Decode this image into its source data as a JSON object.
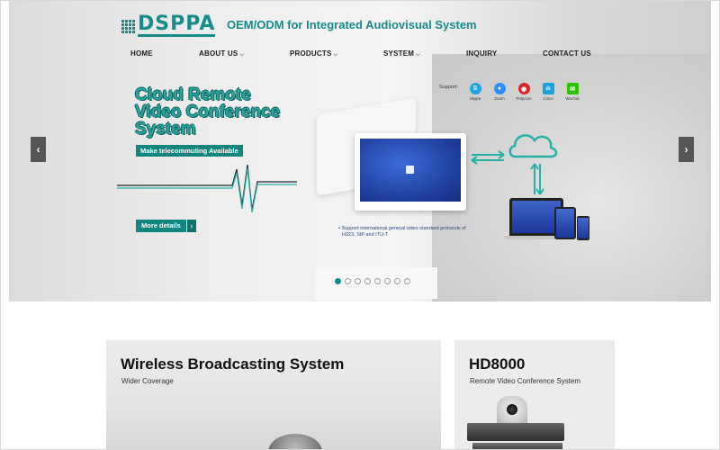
{
  "brand": {
    "logo_text": "DSPPA",
    "tagline": "OEM/ODM for Integrated Audiovisual System",
    "color": "#168c8a"
  },
  "nav": {
    "items": [
      {
        "label": "HOME",
        "has_dropdown": false
      },
      {
        "label": "ABOUT US",
        "has_dropdown": true
      },
      {
        "label": "PRODUCTS",
        "has_dropdown": true
      },
      {
        "label": "SYSTEM",
        "has_dropdown": true
      },
      {
        "label": "INQUIRY",
        "has_dropdown": false
      },
      {
        "label": "CONTACT US",
        "has_dropdown": false
      }
    ]
  },
  "hero": {
    "headline_lines": [
      "Cloud Remote",
      "Video Conference",
      "System"
    ],
    "badge": "Make telecommuting Available",
    "more_button": "More details",
    "support_label": "Support:",
    "apps": [
      {
        "name": "Skype",
        "icon": "skype-icon",
        "color": "#1fa3e4",
        "glyph": "S"
      },
      {
        "name": "Zoom",
        "icon": "zoom-icon",
        "color": "#2d8cff",
        "glyph": "●"
      },
      {
        "name": "Polycom",
        "icon": "polycom-icon",
        "color": "#d6262b",
        "glyph": "◉"
      },
      {
        "name": "Cisco",
        "icon": "cisco-icon",
        "color": "#1ba0d7",
        "glyph": "ılı"
      },
      {
        "name": "Wechat",
        "icon": "wechat-icon",
        "color": "#2dc100",
        "glyph": "✉"
      }
    ],
    "description_lines": [
      "Support international general video standard protocols of",
      "H323, SIP and ITU-T"
    ],
    "prev_arrow": "‹",
    "next_arrow": "›",
    "slide_count": 8,
    "active_slide": 1
  },
  "cards": [
    {
      "title": "Wireless Broadcasting System",
      "subtitle": "Wider Coverage"
    },
    {
      "title": "HD8000",
      "subtitle": "Remote Video Conference System"
    }
  ],
  "colors": {
    "accent": "#168c8a",
    "button": "#12857f",
    "headline": "#2aa39d"
  }
}
